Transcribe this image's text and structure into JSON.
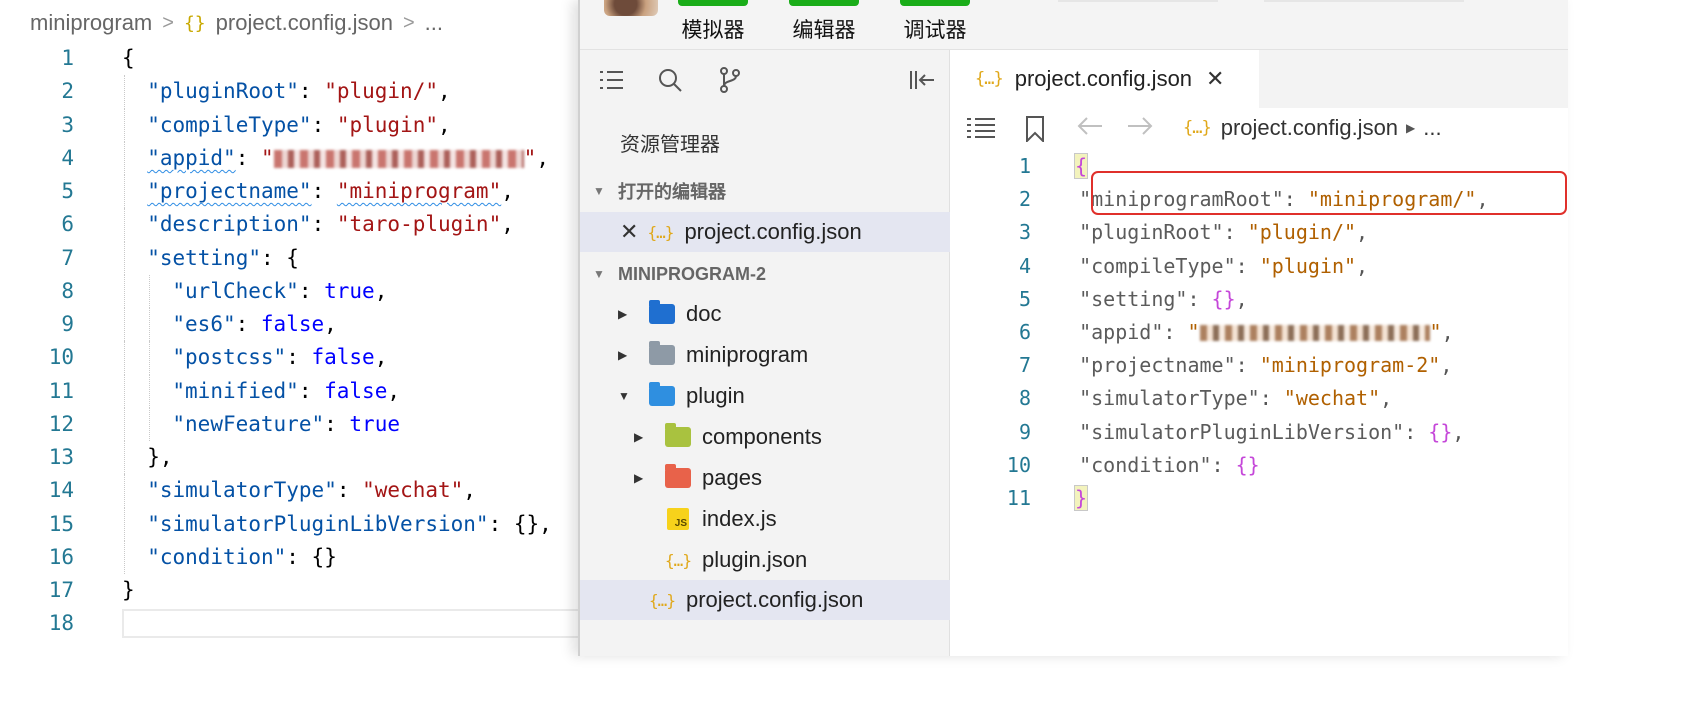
{
  "left_editor": {
    "breadcrumb": {
      "folder": "miniprogram",
      "sep": ">",
      "icon": "{}",
      "file": "project.config.json",
      "sep2": ">",
      "more": "..."
    },
    "lines": [
      {
        "n": "1",
        "tokens": [
          [
            "k-punc",
            "{"
          ]
        ]
      },
      {
        "n": "2",
        "indent": 1,
        "tokens": [
          [
            "k-key",
            "\"pluginRoot\""
          ],
          [
            "k-punc",
            ": "
          ],
          [
            "k-str",
            "\"plugin/\""
          ],
          [
            "k-punc",
            ","
          ]
        ]
      },
      {
        "n": "3",
        "indent": 1,
        "tokens": [
          [
            "k-key",
            "\"compileType\""
          ],
          [
            "k-punc",
            ": "
          ],
          [
            "k-str",
            "\"plugin\""
          ],
          [
            "k-punc",
            ","
          ]
        ]
      },
      {
        "n": "4",
        "indent": 1,
        "tokens": [
          [
            "k-key squiggle",
            "\"appid\""
          ],
          [
            "k-punc",
            ": "
          ],
          [
            "k-str",
            "\""
          ],
          [
            "blur",
            ""
          ],
          [
            "k-str",
            "\""
          ],
          [
            "k-punc",
            ","
          ]
        ]
      },
      {
        "n": "5",
        "indent": 1,
        "tokens": [
          [
            "k-key squiggle",
            "\"projectname\""
          ],
          [
            "k-punc",
            ": "
          ],
          [
            "k-str squiggle",
            "\"miniprogram\""
          ],
          [
            "k-punc",
            ","
          ]
        ]
      },
      {
        "n": "6",
        "indent": 1,
        "tokens": [
          [
            "k-key",
            "\"description\""
          ],
          [
            "k-punc",
            ": "
          ],
          [
            "k-str",
            "\"taro-plugin\""
          ],
          [
            "k-punc",
            ","
          ]
        ]
      },
      {
        "n": "7",
        "indent": 1,
        "tokens": [
          [
            "k-key",
            "\"setting\""
          ],
          [
            "k-punc",
            ": {"
          ]
        ]
      },
      {
        "n": "8",
        "indent": 2,
        "tokens": [
          [
            "k-key",
            "\"urlCheck\""
          ],
          [
            "k-punc",
            ": "
          ],
          [
            "k-bool",
            "true"
          ],
          [
            "k-punc",
            ","
          ]
        ]
      },
      {
        "n": "9",
        "indent": 2,
        "tokens": [
          [
            "k-key",
            "\"es6\""
          ],
          [
            "k-punc",
            ": "
          ],
          [
            "k-bool",
            "false"
          ],
          [
            "k-punc",
            ","
          ]
        ]
      },
      {
        "n": "10",
        "indent": 2,
        "tokens": [
          [
            "k-key",
            "\"postcss\""
          ],
          [
            "k-punc",
            ": "
          ],
          [
            "k-bool",
            "false"
          ],
          [
            "k-punc",
            ","
          ]
        ]
      },
      {
        "n": "11",
        "indent": 2,
        "tokens": [
          [
            "k-key",
            "\"minified\""
          ],
          [
            "k-punc",
            ": "
          ],
          [
            "k-bool",
            "false"
          ],
          [
            "k-punc",
            ","
          ]
        ]
      },
      {
        "n": "12",
        "indent": 2,
        "tokens": [
          [
            "k-key",
            "\"newFeature\""
          ],
          [
            "k-punc",
            ": "
          ],
          [
            "k-bool",
            "true"
          ]
        ]
      },
      {
        "n": "13",
        "indent": 1,
        "tokens": [
          [
            "k-punc",
            "},"
          ]
        ]
      },
      {
        "n": "14",
        "indent": 1,
        "tokens": [
          [
            "k-key",
            "\"simulatorType\""
          ],
          [
            "k-punc",
            ": "
          ],
          [
            "k-str",
            "\"wechat\""
          ],
          [
            "k-punc",
            ","
          ]
        ]
      },
      {
        "n": "15",
        "indent": 1,
        "tokens": [
          [
            "k-key",
            "\"simulatorPluginLibVersion\""
          ],
          [
            "k-punc",
            ": {},"
          ]
        ]
      },
      {
        "n": "16",
        "indent": 1,
        "tokens": [
          [
            "k-key",
            "\"condition\""
          ],
          [
            "k-punc",
            ": {}"
          ]
        ]
      },
      {
        "n": "17",
        "tokens": [
          [
            "k-punc",
            "}"
          ]
        ]
      },
      {
        "n": "18",
        "current": true,
        "tokens": []
      }
    ]
  },
  "toolbar": {
    "buttons": [
      {
        "id": "simulator",
        "label": "模拟器"
      },
      {
        "id": "editor",
        "label": "编辑器"
      },
      {
        "id": "debugger",
        "label": "调试器"
      }
    ],
    "accent": "#1aad19"
  },
  "explorer": {
    "title": "资源管理器",
    "open_editors_label": "打开的编辑器",
    "open_editor_file": "project.config.json",
    "project_label": "MINIPROGRAM-2",
    "tree": [
      {
        "label": "doc",
        "type": "folder",
        "color": "#1f6fd0",
        "expanded": false
      },
      {
        "label": "miniprogram",
        "type": "folder",
        "color": "#8e9aa6",
        "expanded": false
      },
      {
        "label": "plugin",
        "type": "folder",
        "color": "#2f8fe0",
        "expanded": true
      },
      {
        "label": "components",
        "type": "folder",
        "color": "#a9c23f",
        "expanded": false
      },
      {
        "label": "pages",
        "type": "folder",
        "color": "#e8624a",
        "expanded": false
      },
      {
        "label": "index.js",
        "type": "js"
      },
      {
        "label": "plugin.json",
        "type": "json"
      },
      {
        "label": "project.config.json",
        "type": "json",
        "selected": true
      }
    ]
  },
  "editor": {
    "tab_label": "project.config.json",
    "crumb_file": "project.config.json",
    "crumb_more": "...",
    "lines": [
      {
        "n": "1",
        "tokens": [
          [
            "r-brace bracket-hl",
            "{"
          ]
        ]
      },
      {
        "n": "2",
        "tokens": [
          [
            "r-key",
            "  \"miniprogramRoot\""
          ],
          [
            "r-punc",
            ": "
          ],
          [
            "r-str",
            "\"miniprogram/\""
          ],
          [
            "r-punc",
            ","
          ]
        ]
      },
      {
        "n": "3",
        "tokens": [
          [
            "r-key",
            "  \"pluginRoot\""
          ],
          [
            "r-punc",
            ": "
          ],
          [
            "r-str",
            "\"plugin/\""
          ],
          [
            "r-punc",
            ","
          ]
        ]
      },
      {
        "n": "4",
        "tokens": [
          [
            "r-key",
            "  \"compileType\""
          ],
          [
            "r-punc",
            ": "
          ],
          [
            "r-str",
            "\"plugin\""
          ],
          [
            "r-punc",
            ","
          ]
        ]
      },
      {
        "n": "5",
        "tokens": [
          [
            "r-key",
            "  \"setting\""
          ],
          [
            "r-punc",
            ": "
          ],
          [
            "r-brace",
            "{}"
          ],
          [
            "r-punc",
            ","
          ]
        ]
      },
      {
        "n": "6",
        "tokens": [
          [
            "r-key",
            "  \"appid\""
          ],
          [
            "r-punc",
            ": "
          ],
          [
            "r-str",
            "\""
          ],
          [
            "blur-r",
            ""
          ],
          [
            "r-str",
            "\""
          ],
          [
            "r-punc",
            ","
          ]
        ]
      },
      {
        "n": "7",
        "tokens": [
          [
            "r-key",
            "  \"projectname\""
          ],
          [
            "r-punc",
            ": "
          ],
          [
            "r-str",
            "\"miniprogram-2\""
          ],
          [
            "r-punc",
            ","
          ]
        ]
      },
      {
        "n": "8",
        "tokens": [
          [
            "r-key",
            "  \"simulatorType\""
          ],
          [
            "r-punc",
            ": "
          ],
          [
            "r-str",
            "\"wechat\""
          ],
          [
            "r-punc",
            ","
          ]
        ]
      },
      {
        "n": "9",
        "tokens": [
          [
            "r-key",
            "  \"simulatorPluginLibVersion\""
          ],
          [
            "r-punc",
            ": "
          ],
          [
            "r-brace",
            "{}"
          ],
          [
            "r-punc",
            ","
          ]
        ]
      },
      {
        "n": "10",
        "tokens": [
          [
            "r-key",
            "  \"condition\""
          ],
          [
            "r-punc",
            ": "
          ],
          [
            "r-brace",
            "{}"
          ]
        ]
      },
      {
        "n": "11",
        "tokens": [
          [
            "r-brace bracket-hl",
            "}"
          ]
        ]
      }
    ],
    "highlight_color": "#e0302b"
  },
  "icons": {
    "explorer_toolbar": [
      "list-icon",
      "search-icon",
      "branch-icon",
      "collapse-sidebar-icon"
    ],
    "editor_toolbar": [
      "outline-icon",
      "bookmark-icon",
      "back-arrow-icon",
      "forward-arrow-icon"
    ]
  }
}
